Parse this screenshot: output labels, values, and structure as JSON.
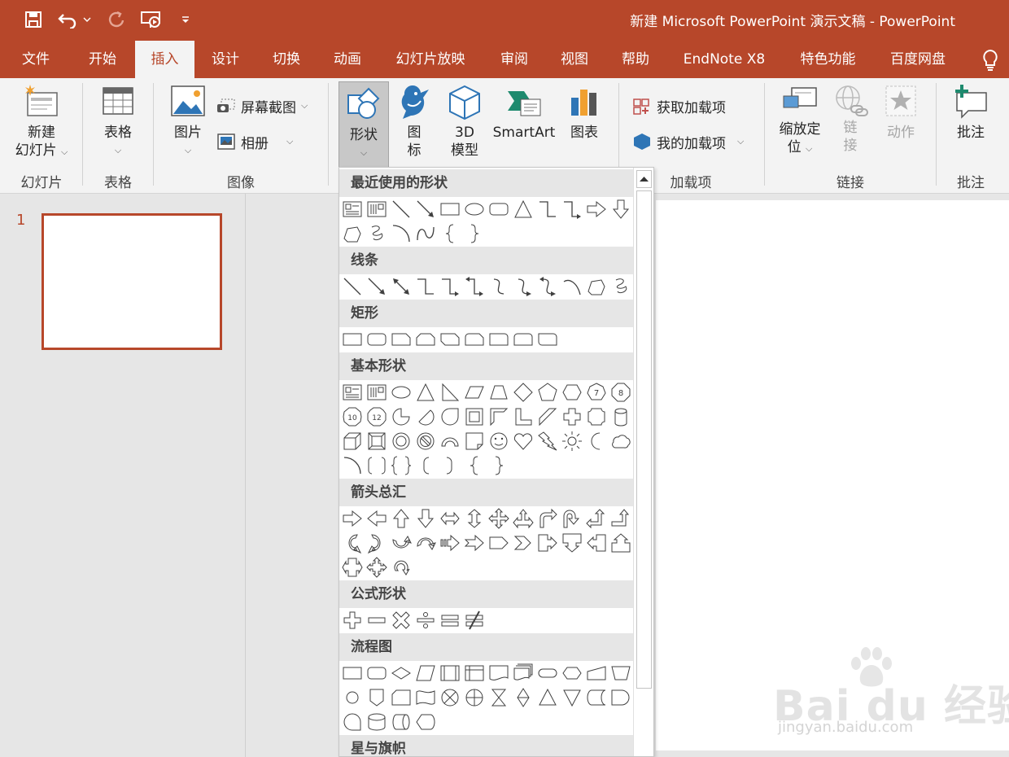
{
  "window": {
    "title": "新建 Microsoft PowerPoint 演示文稿  -  PowerPoint",
    "accent": "#b7472a"
  },
  "quick_access": [
    {
      "icon": "save-icon"
    },
    {
      "icon": "undo-icon"
    },
    {
      "icon": "redo-icon"
    },
    {
      "icon": "present-from-start-icon"
    },
    {
      "icon": "customize-qat-icon"
    }
  ],
  "tabs": [
    {
      "label": "文件"
    },
    {
      "label": "开始"
    },
    {
      "label": "插入"
    },
    {
      "label": "设计"
    },
    {
      "label": "切换"
    },
    {
      "label": "动画"
    },
    {
      "label": "幻灯片放映"
    },
    {
      "label": "审阅"
    },
    {
      "label": "视图"
    },
    {
      "label": "帮助"
    },
    {
      "label": "EndNote X8"
    },
    {
      "label": "特色功能"
    },
    {
      "label": "百度网盘"
    }
  ],
  "active_tab": "插入",
  "ribbon": {
    "new_slide": {
      "line1": "新建",
      "line2": "幻灯片"
    },
    "table": {
      "label": "表格"
    },
    "picture": {
      "label": "图片"
    },
    "screenshot": {
      "label": "屏幕截图"
    },
    "album": {
      "label": "相册"
    },
    "shapes": {
      "label": "形状"
    },
    "icons": {
      "line1": "图",
      "line2": "标"
    },
    "model3d": {
      "line1": "3D",
      "line2": "模型"
    },
    "smartart": {
      "label": "SmartArt"
    },
    "chart": {
      "label": "图表"
    },
    "get_addins": {
      "label": "获取加载项"
    },
    "my_addins": {
      "label": "我的加载项"
    },
    "zoom": {
      "line1": "缩放定",
      "line2": "位"
    },
    "link": {
      "line1": "链",
      "line2": "接"
    },
    "action": {
      "label": "动作"
    },
    "comment": {
      "label": "批注"
    },
    "groups": {
      "slides": "幻灯片",
      "tables": "表格",
      "images": "图像",
      "addins": "加载项",
      "links": "链接",
      "comments": "批注"
    }
  },
  "thumbnails": {
    "slide_number": "1"
  },
  "gallery": {
    "categories": [
      {
        "label": "最近使用的形状"
      },
      {
        "label": "线条"
      },
      {
        "label": "矩形"
      },
      {
        "label": "基本形状"
      },
      {
        "label": "箭头总汇"
      },
      {
        "label": "公式形状"
      },
      {
        "label": "流程图"
      },
      {
        "label": "星与旗帜"
      }
    ]
  },
  "watermark": {
    "text": "Bai du 经验",
    "url": "jingyan.baidu.com"
  }
}
